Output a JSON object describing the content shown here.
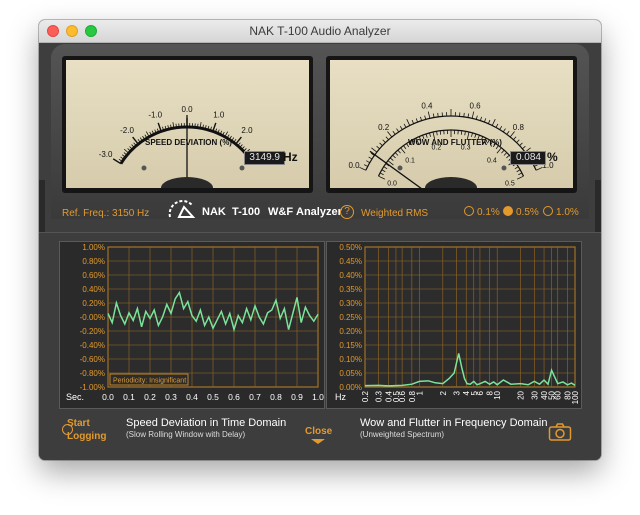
{
  "window": {
    "title": "NAK T-100 Audio Analyzer"
  },
  "meter_left": {
    "title": "SPEED DEVIATION (%)",
    "scale_labels": [
      "-3.0",
      "-2.0",
      "-1.0",
      "0.0",
      "1.0",
      "2.0",
      "3.0"
    ],
    "readout": "3149.9",
    "unit": "Hz"
  },
  "meter_right": {
    "title": "WOW AND FLUTTER (%)",
    "outer_scale_labels": [
      "0.0",
      "0.2",
      "0.4",
      "0.6",
      "0.8",
      "1.0"
    ],
    "inner_scale_labels": [
      "0.0",
      "0.1",
      "0.2",
      "0.3",
      "0.4",
      "0.5"
    ],
    "readout": "0.084",
    "unit": "%"
  },
  "controls": {
    "ref_freq": "Ref. Freq.: 3150 Hz",
    "brand_nak": "NAK",
    "brand_model": "T-100",
    "brand_wf": "W&F",
    "brand_analyzer": "Analyzer",
    "help_label": "?",
    "weighted_rms": "Weighted RMS",
    "range_options": [
      "0.1%",
      "0.5%",
      "1.0%"
    ],
    "range_selected": "0.5%"
  },
  "chart_data": [
    {
      "type": "line",
      "title": "Speed Deviation in Time Domain",
      "subtitle": "(Slow Rolling Window with Delay)",
      "xlabel": "Sec.",
      "x_ticks": [
        "0.0",
        "0.1",
        "0.2",
        "0.3",
        "0.4",
        "0.5",
        "0.6",
        "0.7",
        "0.8",
        "0.9",
        "1.0"
      ],
      "y_ticks": [
        "1.00%",
        "0.80%",
        "0.60%",
        "0.40%",
        "0.20%",
        "-0.00%",
        "-0.20%",
        "-0.40%",
        "-0.60%",
        "-0.80%",
        "-1.00%"
      ],
      "xlim": [
        0,
        1
      ],
      "ylim": [
        -1,
        1
      ],
      "annotation": "Periodicity: Insignificant",
      "series": [
        {
          "color": "#7be39a",
          "x": [
            0.0,
            0.02,
            0.04,
            0.06,
            0.08,
            0.1,
            0.12,
            0.14,
            0.16,
            0.18,
            0.2,
            0.22,
            0.24,
            0.26,
            0.28,
            0.3,
            0.32,
            0.34,
            0.36,
            0.38,
            0.4,
            0.42,
            0.44,
            0.46,
            0.48,
            0.5,
            0.52,
            0.54,
            0.56,
            0.58,
            0.6,
            0.62,
            0.64,
            0.66,
            0.68,
            0.7,
            0.72,
            0.74,
            0.76,
            0.78,
            0.8,
            0.82,
            0.84,
            0.86,
            0.88,
            0.9,
            0.92,
            0.94,
            0.96,
            0.98,
            1.0
          ],
          "values": [
            0.05,
            -0.08,
            0.2,
            0.02,
            -0.1,
            0.06,
            -0.05,
            0.12,
            -0.14,
            0.08,
            -0.02,
            0.1,
            -0.12,
            0.0,
            0.18,
            0.05,
            0.26,
            0.35,
            0.12,
            0.22,
            0.02,
            -0.06,
            0.1,
            -0.12,
            0.0,
            -0.16,
            -0.04,
            0.08,
            -0.1,
            0.05,
            -0.18,
            0.02,
            -0.08,
            0.12,
            -0.04,
            0.16,
            0.0,
            -0.1,
            0.06,
            0.1,
            0.24,
            -0.02,
            0.12,
            -0.18,
            0.05,
            0.28,
            -0.08,
            0.14,
            0.02,
            -0.06,
            0.04
          ]
        }
      ]
    },
    {
      "type": "line",
      "title": "Wow and Flutter in Frequency Domain",
      "subtitle": "(Unweighted Spectrum)",
      "xlabel": "Hz",
      "x_ticks": [
        "0.2",
        "0.3",
        "0.4",
        "0.5",
        "0.6",
        "0.8",
        "1",
        "2",
        "3",
        "4",
        "5",
        "6",
        "8",
        "10",
        "20",
        "30",
        "40",
        "50",
        "60",
        "80",
        "100"
      ],
      "y_ticks": [
        "0.50%",
        "0.45%",
        "0.40%",
        "0.35%",
        "0.30%",
        "0.25%",
        "0.20%",
        "0.15%",
        "0.10%",
        "0.05%",
        "0.00%"
      ],
      "xlim": [
        0.2,
        100
      ],
      "x_scale": "log",
      "ylim": [
        0,
        0.5
      ],
      "series": [
        {
          "color": "#7be39a",
          "x": [
            0.2,
            0.3,
            0.4,
            0.6,
            0.8,
            1,
            1.3,
            1.6,
            2,
            2.4,
            2.8,
            3.2,
            3.5,
            3.8,
            4.1,
            4.5,
            5,
            5.5,
            6,
            7,
            8,
            9,
            10,
            12,
            15,
            20,
            25,
            30,
            35,
            40,
            45,
            50,
            60,
            70,
            80,
            90,
            100
          ],
          "values": [
            0.005,
            0.006,
            0.004,
            0.006,
            0.01,
            0.02,
            0.022,
            0.015,
            0.012,
            0.03,
            0.05,
            0.12,
            0.07,
            0.03,
            0.012,
            0.01,
            0.02,
            0.008,
            0.012,
            0.02,
            0.01,
            0.018,
            0.008,
            0.025,
            0.01,
            0.012,
            0.008,
            0.02,
            0.01,
            0.025,
            0.01,
            0.06,
            0.012,
            0.018,
            0.008,
            0.014,
            0.006
          ]
        }
      ]
    }
  ],
  "bottom": {
    "start_label_1": "Start",
    "start_label_2": "Logging",
    "close_label": "Close"
  }
}
